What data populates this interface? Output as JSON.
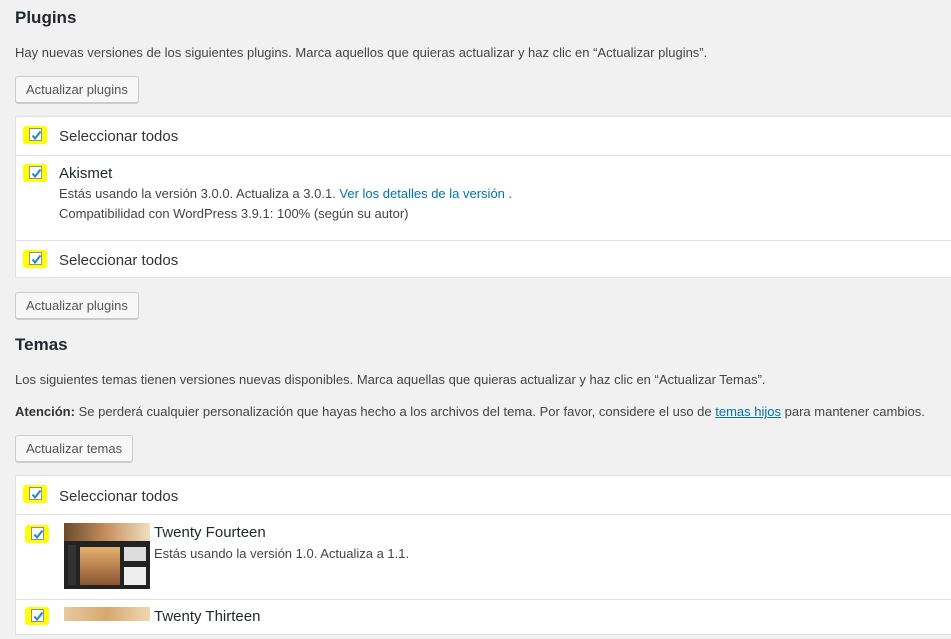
{
  "plugins": {
    "heading": "Plugins",
    "intro": "Hay nuevas versiones de los siguientes plugins. Marca aquellos que quieras actualizar y haz clic en “Actualizar plugins”.",
    "update_button": "Actualizar plugins",
    "select_all": "Seleccionar todos",
    "items": [
      {
        "name": "Akismet",
        "version_text": "Estás usando la versión 3.0.0. Actualiza a 3.0.1.",
        "details_link": "Ver los detalles de la versión",
        "after_link": ".",
        "compat": "Compatibilidad con WordPress 3.9.1: 100% (según su autor)"
      }
    ]
  },
  "themes": {
    "heading": "Temas",
    "intro": "Los siguientes temas tienen versiones nuevas disponibles. Marca aquellas que quieras actualizar y haz clic en “Actualizar Temas”.",
    "warning_label": "Atención:",
    "warning_text": "Se perderá cualquier personalización que hayas hecho a los archivos del tema. Por favor, considere el uso de",
    "warning_link": "temas hijos",
    "warning_after": "para mantener cambios.",
    "update_button": "Actualizar temas",
    "select_all": "Seleccionar todos",
    "items": [
      {
        "name": "Twenty Fourteen",
        "version_text": "Estás usando la versión 1.0. Actualiza a 1.1."
      },
      {
        "name": "Twenty Thirteen"
      }
    ]
  },
  "colors": {
    "highlight": "#ffff00",
    "link": "#0073aa"
  }
}
